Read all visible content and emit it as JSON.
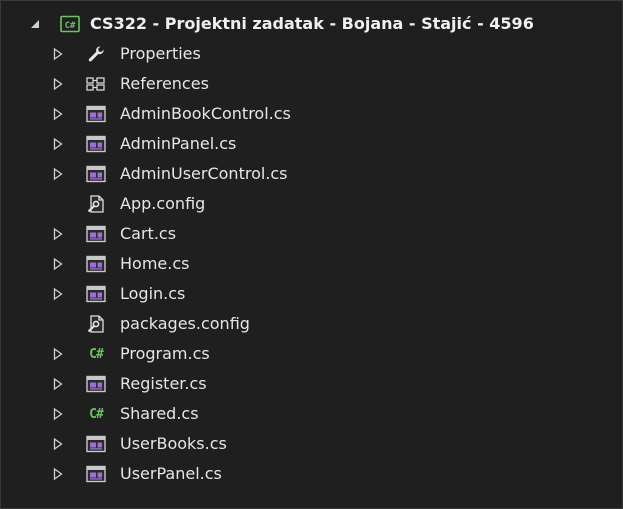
{
  "tree": {
    "project": {
      "label": "CS322 - Projektni zadatak - Bojana - Stajić - 4596",
      "icon": "csharp-project-icon",
      "expanded": true
    },
    "items": [
      {
        "label": "Properties",
        "icon": "wrench-icon",
        "expandable": true
      },
      {
        "label": "References",
        "icon": "references-icon",
        "expandable": true
      },
      {
        "label": "AdminBookControl.cs",
        "icon": "form-icon",
        "expandable": true
      },
      {
        "label": "AdminPanel.cs",
        "icon": "form-icon",
        "expandable": true
      },
      {
        "label": "AdminUserControl.cs",
        "icon": "form-icon",
        "expandable": true
      },
      {
        "label": "App.config",
        "icon": "config-file-icon",
        "expandable": false
      },
      {
        "label": "Cart.cs",
        "icon": "form-icon",
        "expandable": true
      },
      {
        "label": "Home.cs",
        "icon": "form-icon",
        "expandable": true
      },
      {
        "label": "Login.cs",
        "icon": "form-icon",
        "expandable": true
      },
      {
        "label": "packages.config",
        "icon": "config-file-icon",
        "expandable": false
      },
      {
        "label": "Program.cs",
        "icon": "csharp-file-icon",
        "expandable": true
      },
      {
        "label": "Register.cs",
        "icon": "form-icon",
        "expandable": true
      },
      {
        "label": "Shared.cs",
        "icon": "csharp-file-icon",
        "expandable": true
      },
      {
        "label": "UserBooks.cs",
        "icon": "form-icon",
        "expandable": true
      },
      {
        "label": "UserPanel.cs",
        "icon": "form-icon",
        "expandable": true
      }
    ]
  },
  "colors": {
    "background": "#1f1f1f",
    "text": "#e6e6e6",
    "csharp_green": "#69c35e",
    "form_purple": "#9b6fd6",
    "form_frame": "#c8c8c8"
  }
}
